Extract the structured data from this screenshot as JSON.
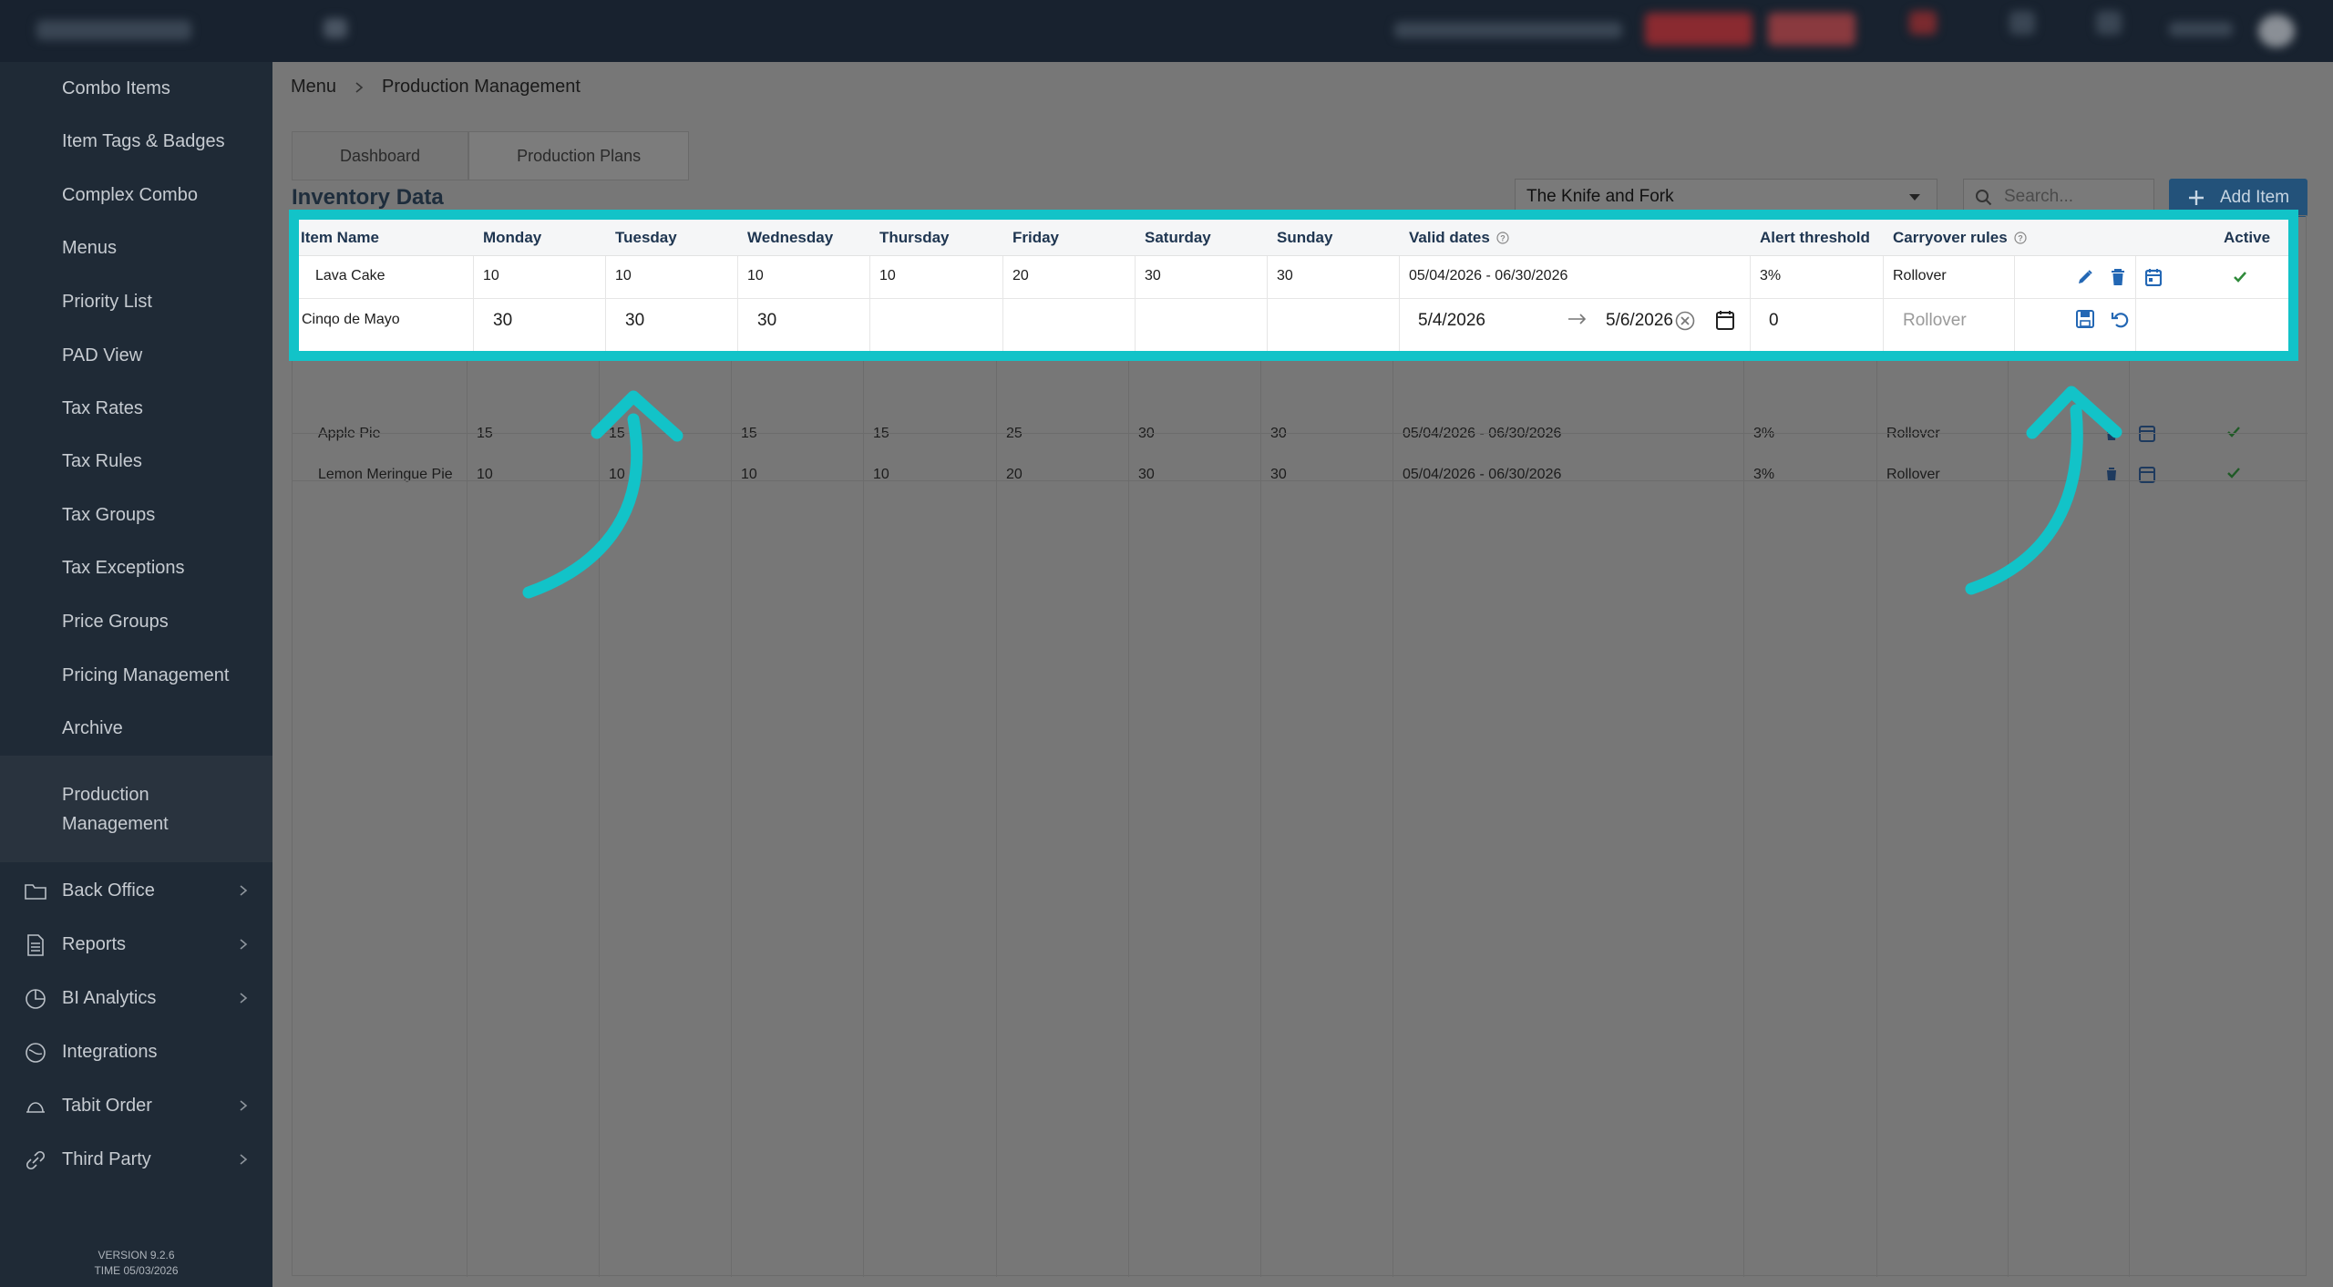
{
  "sidebar": {
    "items": [
      "Combo Items",
      "Item Tags & Badges",
      "Complex Combo",
      "Menus",
      "Priority List",
      "PAD View",
      "Tax Rates",
      "Tax Rules",
      "Tax Groups",
      "Tax Exceptions",
      "Price Groups",
      "Pricing Management",
      "Archive"
    ],
    "active_item_line1": "Production",
    "active_item_line2": "Management",
    "groups": [
      "Back Office",
      "Reports",
      "BI Analytics",
      "Integrations",
      "Tabit Order",
      "Third Party"
    ],
    "version": "VERSION 9.2.6",
    "time": "TIME 05/03/2026"
  },
  "breadcrumb": {
    "root": "Menu",
    "current": "Production Management"
  },
  "tabs": [
    "Dashboard",
    "Production Plans"
  ],
  "inventory_title": "Inventory Data",
  "location_select": "The Knife and Fork",
  "search_placeholder": "Search...",
  "add_item_label": "Add Item",
  "table": {
    "headers": [
      "Item Name",
      "Monday",
      "Tuesday",
      "Wednesday",
      "Thursday",
      "Friday",
      "Saturday",
      "Sunday",
      "Valid dates",
      "Alert threshold",
      "Carryover rules",
      "",
      "Active"
    ],
    "rows": [
      {
        "name": "Lava Cake",
        "days": [
          "10",
          "10",
          "10",
          "10",
          "20",
          "30",
          "30"
        ],
        "valid": "05/04/2026 - 06/30/2026",
        "threshold": "3%",
        "carryover": "Rollover"
      },
      {
        "name": "Apple Pie",
        "days": [
          "15",
          "15",
          "15",
          "15",
          "25",
          "30",
          "30"
        ],
        "valid": "05/04/2026 - 06/30/2026",
        "threshold": "3%",
        "carryover": "Rollover"
      },
      {
        "name": "Lemon Meringue Pie",
        "days": [
          "10",
          "10",
          "10",
          "10",
          "20",
          "30",
          "30"
        ],
        "valid": "05/04/2026 - 06/30/2026",
        "threshold": "3%",
        "carryover": "Rollover"
      }
    ],
    "edit_row": {
      "name": "Cinqo de Mayo",
      "monday": "30",
      "tuesday": "30",
      "wednesday": "30",
      "start_date": "5/4/2026",
      "end_date": "5/6/2026",
      "threshold": "0",
      "carryover_placeholder": "Rollover"
    }
  },
  "colors": {
    "highlight": "#12c3c8",
    "action_blue": "#2367b4",
    "check_green": "#2f8a3a"
  }
}
